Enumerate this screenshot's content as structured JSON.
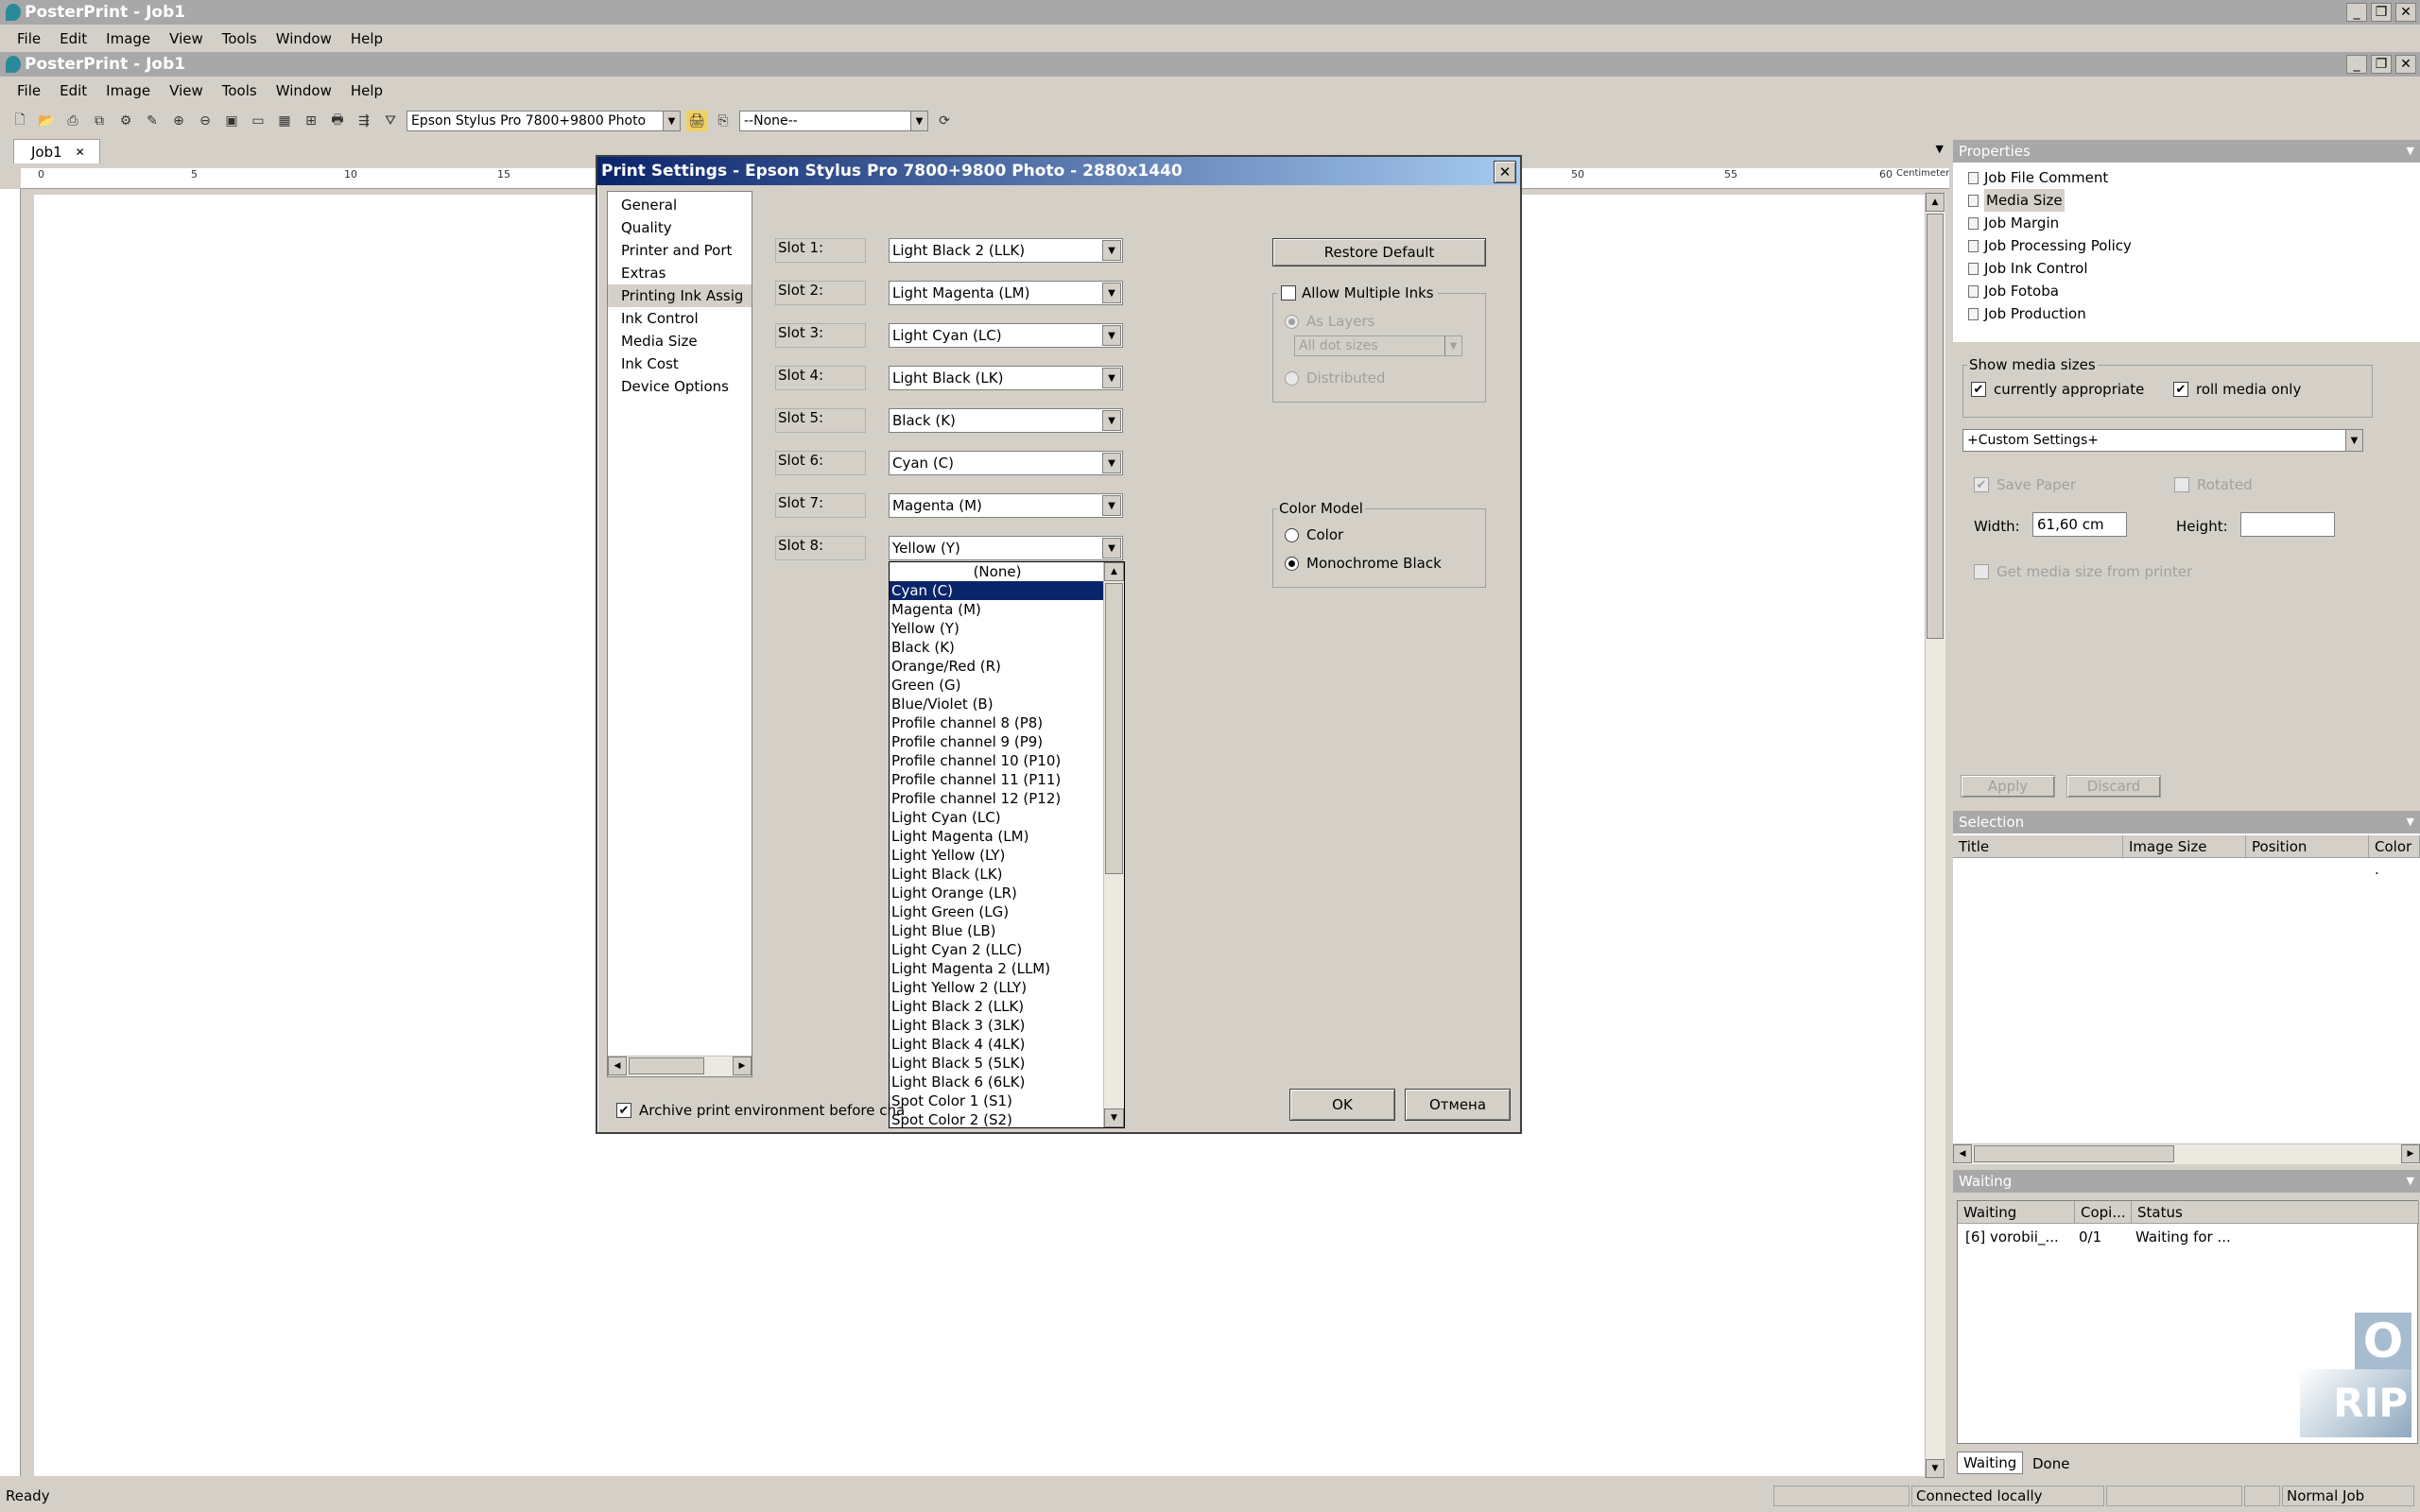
{
  "app": {
    "title": "PosterPrint - Job1",
    "inner_title": "PosterPrint - Job1"
  },
  "menu": [
    "File",
    "Edit",
    "Image",
    "View",
    "Tools",
    "Window",
    "Help"
  ],
  "toolbar": {
    "printer": "Epson Stylus Pro  7800+9800 Photo",
    "preset": "--None--"
  },
  "doc_tab": "Job1",
  "ruler": {
    "marks": [
      "0",
      "5",
      "10",
      "15",
      "50",
      "55",
      "60"
    ],
    "unit": "Centimeter"
  },
  "dialog": {
    "title": "Print Settings - Epson Stylus Pro  7800+9800 Photo - 2880x1440",
    "nav": [
      "General",
      "Quality",
      "Printer and Port",
      "Extras",
      "Printing Ink Assig",
      "Ink Control",
      "Media Size",
      "Ink Cost",
      "Device Options"
    ],
    "nav_selected": 4,
    "slots": [
      {
        "label": "Slot 1:",
        "value": "Light Black 2 (LLK)"
      },
      {
        "label": "Slot 2:",
        "value": "Light Magenta (LM)"
      },
      {
        "label": "Slot 3:",
        "value": "Light Cyan (LC)"
      },
      {
        "label": "Slot 4:",
        "value": "Light Black (LK)"
      },
      {
        "label": "Slot 5:",
        "value": "Black (K)"
      },
      {
        "label": "Slot 6:",
        "value": "Cyan (C)"
      },
      {
        "label": "Slot 7:",
        "value": "Magenta (M)"
      },
      {
        "label": "Slot 8:",
        "value": "Yellow (Y)"
      }
    ],
    "dropdown_options": [
      "(None)",
      "Cyan (C)",
      "Magenta (M)",
      "Yellow (Y)",
      "Black (K)",
      "Orange/Red (R)",
      "Green (G)",
      "Blue/Violet (B)",
      "Profile channel 8 (P8)",
      "Profile channel 9 (P9)",
      "Profile channel 10 (P10)",
      "Profile channel 11 (P11)",
      "Profile channel 12 (P12)",
      "Light Cyan (LC)",
      "Light Magenta (LM)",
      "Light Yellow (LY)",
      "Light Black (LK)",
      "Light Orange (LR)",
      "Light Green (LG)",
      "Light Blue (LB)",
      "Light Cyan 2 (LLC)",
      "Light Magenta 2 (LLM)",
      "Light Yellow 2 (LLY)",
      "Light Black 2 (LLK)",
      "Light Black 3 (3LK)",
      "Light Black 4 (4LK)",
      "Light Black 5 (5LK)",
      "Light Black 6 (6LK)",
      "Spot Color 1 (S1)",
      "Spot Color 2 (S2)"
    ],
    "dropdown_selected": 1,
    "restore_default": "Restore Default",
    "allow_multiple_inks": "Allow Multiple Inks",
    "as_layers": "As Layers",
    "dot_sizes": "All dot sizes",
    "distributed": "Distributed",
    "color_model": {
      "legend": "Color Model",
      "color": "Color",
      "mono": "Monochrome Black",
      "selected": "mono"
    },
    "archive_label": "Archive print environment before cha",
    "archive_checked": true,
    "ok": "OK",
    "cancel": "Отмена"
  },
  "properties": {
    "header": "Properties",
    "items": [
      "Job File Comment",
      "Media Size",
      "Job Margin",
      "Job Processing Policy",
      "Job Ink Control",
      "Job Fotoba",
      "Job Production"
    ],
    "selected": 1,
    "show_media_sizes": "Show media sizes",
    "currently_appropriate": "currently appropriate",
    "roll_media_only": "roll media only",
    "custom_settings": "+Custom Settings+",
    "save_paper": "Save Paper",
    "rotated": "Rotated",
    "width_label": "Width:",
    "width_value": "61,60 cm",
    "height_label": "Height:",
    "height_value": "",
    "get_media_size": "Get media size from printer",
    "apply": "Apply",
    "discard": "Discard"
  },
  "selection": {
    "header": "Selection",
    "columns": [
      "Title",
      "Image Size",
      "Position",
      "Color ."
    ]
  },
  "waiting": {
    "header": "Waiting",
    "columns": [
      "Waiting",
      "Copi...",
      "Status"
    ],
    "rows": [
      {
        "name": "[6]  vorobii_...",
        "copies": "0/1",
        "status": "Waiting for ..."
      }
    ],
    "tabs": [
      "Waiting",
      "Done"
    ]
  },
  "logo": "RIP",
  "status": {
    "left": "Ready",
    "connection": "Connected locally",
    "job_type": "Normal Job"
  }
}
